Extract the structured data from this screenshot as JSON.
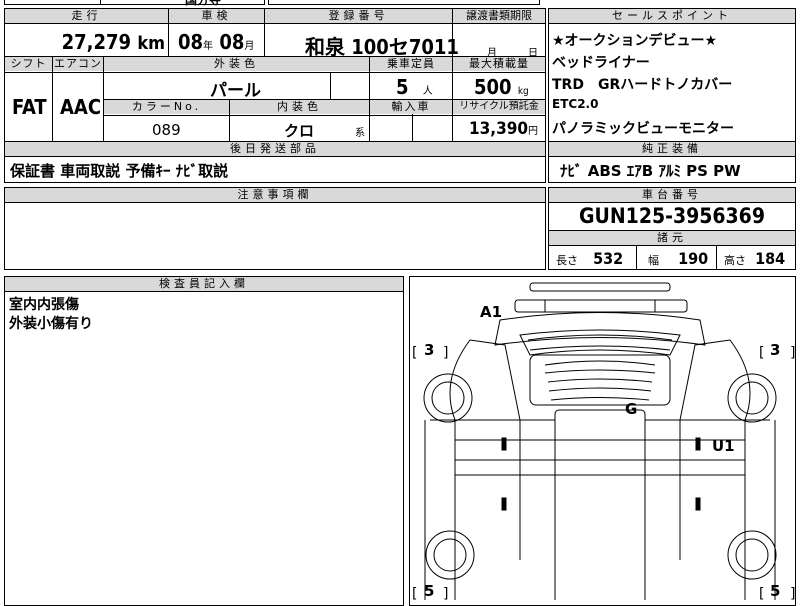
{
  "top_partial": {
    "a": "",
    "b": "国分寺"
  },
  "header": {
    "mileage_label": "走行",
    "inspection_label": "車検",
    "registration_label": "登録番号",
    "transfer_deadline_label": "譲渡書類期限",
    "sales_point_label": "セールスポイント"
  },
  "row1": {
    "mileage": "27,279",
    "mileage_unit": "km",
    "insp_year": "08",
    "insp_year_unit": "年",
    "insp_month": "08",
    "insp_month_unit": "月",
    "plate": "和泉 100セ7011",
    "deadline_month_unit": "月",
    "deadline_day_unit": "日"
  },
  "row2_labels": {
    "shift": "シフト",
    "aircon": "エアコン",
    "exterior_color": "外装色",
    "capacity": "乗車定員",
    "max_load": "最大積載量"
  },
  "row2": {
    "shift": "FAT",
    "aircon": "AAC",
    "exterior_color": "パール",
    "capacity": "5",
    "capacity_unit": "人",
    "max_load": "500",
    "max_load_unit": "kg"
  },
  "row3_labels": {
    "color_no": "カラーNo.",
    "interior_color": "内装色",
    "import": "輸入車",
    "recycle": "リサイクル預託金"
  },
  "row3": {
    "color_no": "089",
    "interior_color": "クロ",
    "interior_unit": "系",
    "recycle_fee": "13,390",
    "recycle_unit": "円"
  },
  "sales_points": [
    "★オークションデビュー★",
    "ベッドライナー",
    "TRD　GRハードトノカバー",
    "ETC2.0",
    "パノラミックビューモニター"
  ],
  "later_parts": {
    "label": "後日発送部品",
    "value": "保証書 車両取説 予備ｷｰ ﾅﾋﾞ取説"
  },
  "standard_equipment": {
    "label": "純正装備",
    "value": "ﾅﾋﾞ ABS ｴｱB ｱﾙﾐ PS PW"
  },
  "notes": {
    "label": "注意事項欄"
  },
  "chassis": {
    "label": "車台番号",
    "value": "GUN125-3956369"
  },
  "specs": {
    "label": "諸元",
    "length_label": "長さ",
    "length": "532",
    "width_label": "幅",
    "width": "190",
    "height_label": "高さ",
    "height": "184"
  },
  "inspector": {
    "label": "検査員記入欄",
    "lines": [
      "室内内張傷",
      "外装小傷有り"
    ]
  },
  "diagram": {
    "marks": [
      "A1",
      "G",
      "U1"
    ],
    "tire_left_top": "3",
    "tire_right_top": "3",
    "tire_left_bottom": "5",
    "tire_right_bottom": "5"
  }
}
